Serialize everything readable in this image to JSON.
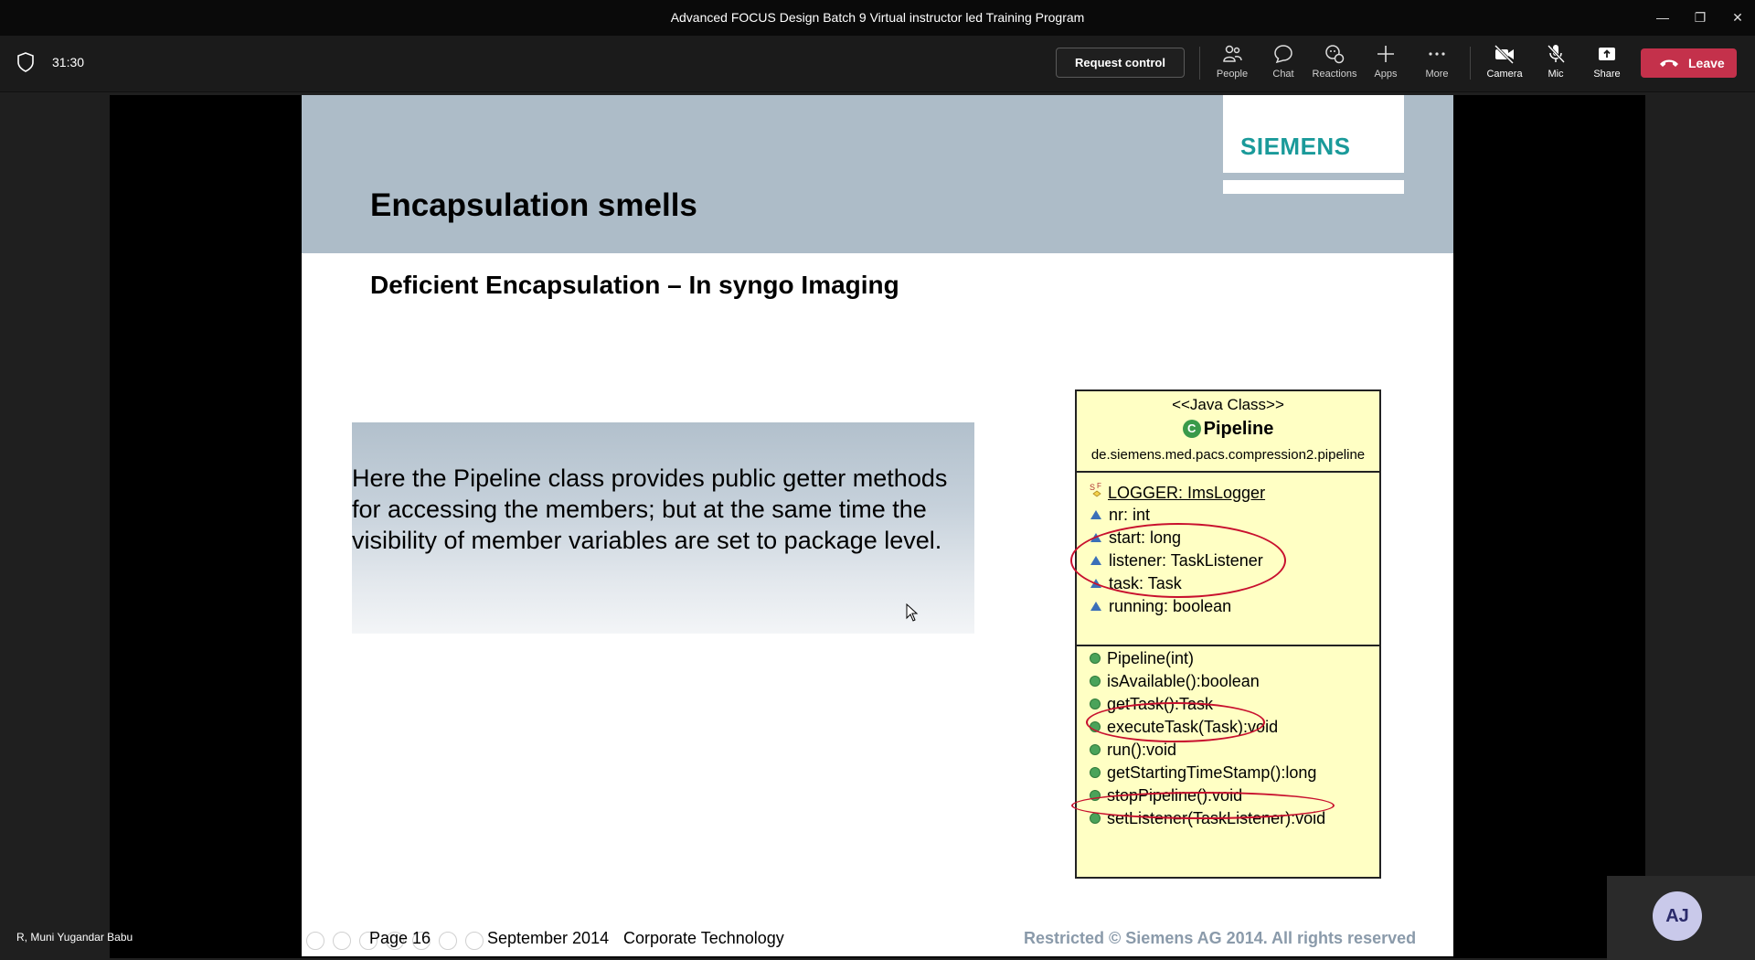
{
  "window": {
    "title": "Advanced FOCUS Design Batch 9 Virtual instructor led Training Program"
  },
  "toolbar": {
    "timer": "31:30",
    "request_control": "Request control",
    "tools": {
      "people": "People",
      "chat": "Chat",
      "reactions": "Reactions",
      "apps": "Apps",
      "more": "More",
      "camera": "Camera",
      "mic": "Mic",
      "share": "Share"
    },
    "leave": "Leave",
    "leave_color": "#c4314b"
  },
  "slide": {
    "title": "Encapsulation smells",
    "logo": "SIEMENS",
    "logo_color": "#1a9a9a",
    "header_color": "#adbcc8",
    "subtitle": "Deficient Encapsulation – In syngo Imaging",
    "body": "Here the Pipeline class provides public getter methods for accessing the members; but at the same time the visibility of member variables are set to package level.",
    "uml": {
      "stereotype": "<<Java Class>>",
      "class_icon": "C",
      "class_name": "Pipeline",
      "package": "de.siemens.med.pacs.compression2.pipeline",
      "fields": [
        "LOGGER: ImsLogger",
        "nr: int",
        "start: long",
        "listener: TaskListener",
        "task: Task",
        "running: boolean"
      ],
      "methods": [
        "Pipeline(int)",
        "isAvailable():boolean",
        "getTask():Task",
        "executeTask(Task):void",
        "run():void",
        "getStartingTimeStamp():long",
        "stopPipeline():void",
        "setListener(TaskListener):void"
      ],
      "highlight_color": "#c8102e"
    },
    "footer": {
      "page": "Page 16",
      "date": "September 2014",
      "org": "Corporate Technology",
      "rights": "Restricted © Siemens AG 2014. All rights reserved"
    }
  },
  "presenter": {
    "name": "R, Muni Yugandar Babu"
  },
  "self_view": {
    "initials": "AJ"
  }
}
